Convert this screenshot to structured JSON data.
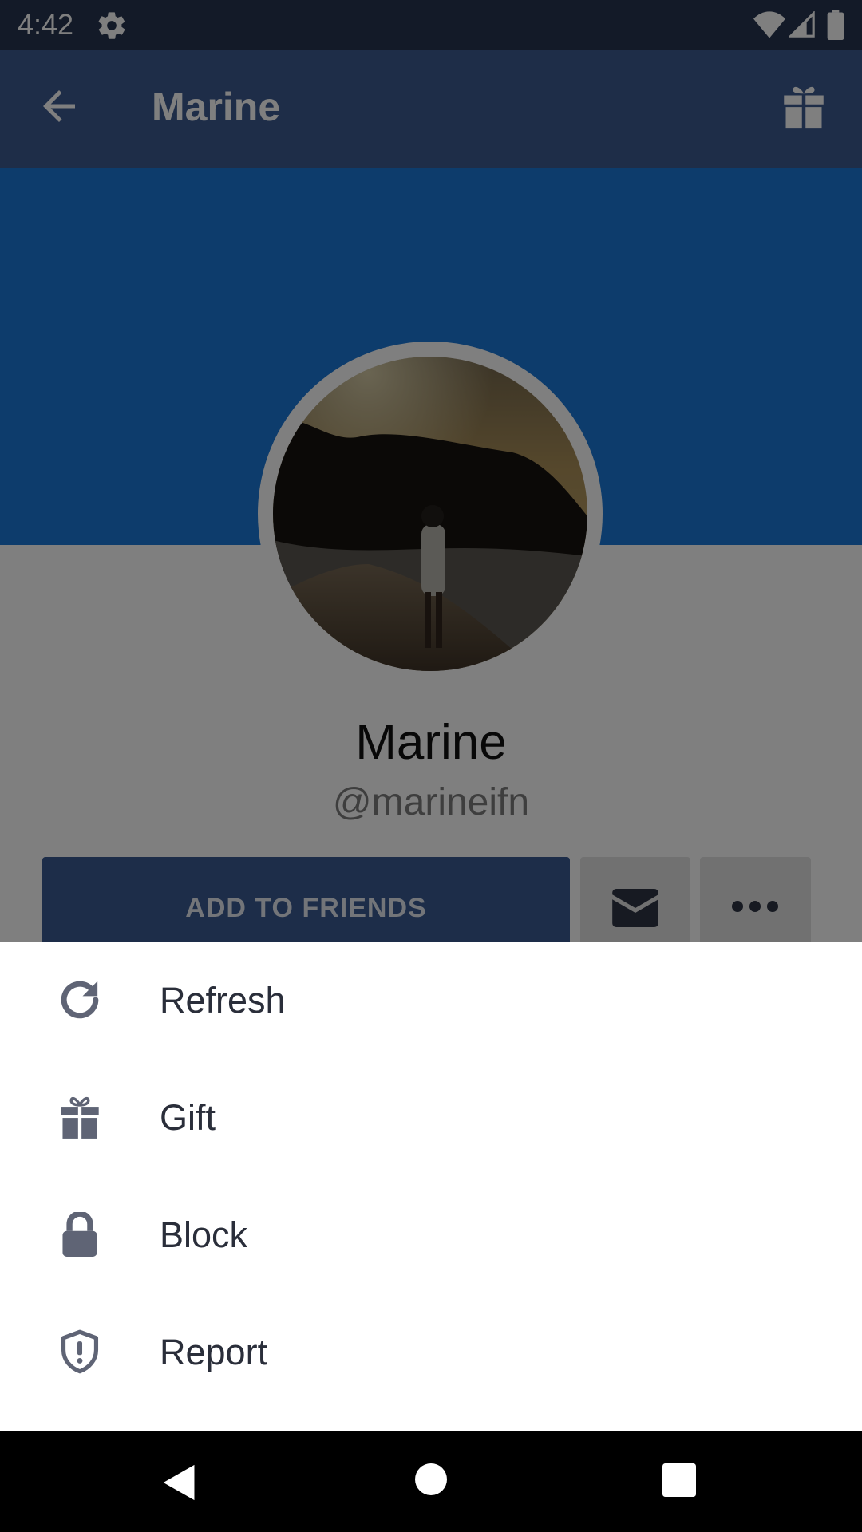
{
  "status_bar": {
    "time": "4:42",
    "icons": [
      "gear-icon",
      "wifi-icon",
      "cell-signal-icon",
      "battery-icon"
    ]
  },
  "app_bar": {
    "title": "Marine",
    "back_icon": "arrow-back-icon",
    "action_icon": "gift-icon"
  },
  "profile": {
    "name": "Marine",
    "handle": "@marineifn",
    "avatar": "profile photo: person standing on a beach at dusk"
  },
  "actions": {
    "add_friends_label": "ADD TO FRIENDS",
    "message_icon": "envelope-icon",
    "more_icon": "more-horizontal-icon"
  },
  "sheet": {
    "items": [
      {
        "label": "Refresh",
        "icon": "refresh-icon"
      },
      {
        "label": "Gift",
        "icon": "gift-icon"
      },
      {
        "label": "Block",
        "icon": "lock-icon"
      },
      {
        "label": "Report",
        "icon": "shield-alert-icon"
      }
    ]
  },
  "nav_bar": {
    "icons": [
      "nav-back-icon",
      "nav-home-icon",
      "nav-recents-icon"
    ]
  },
  "colors": {
    "status_bar": "#263550",
    "app_bar": "#3c5a90",
    "cover": "#1b79d9",
    "primary_button": "#3a5a93",
    "secondary_button": "#e3e3e3",
    "sheet_icon": "#5f6475",
    "sheet_text": "#2a2e3a"
  }
}
